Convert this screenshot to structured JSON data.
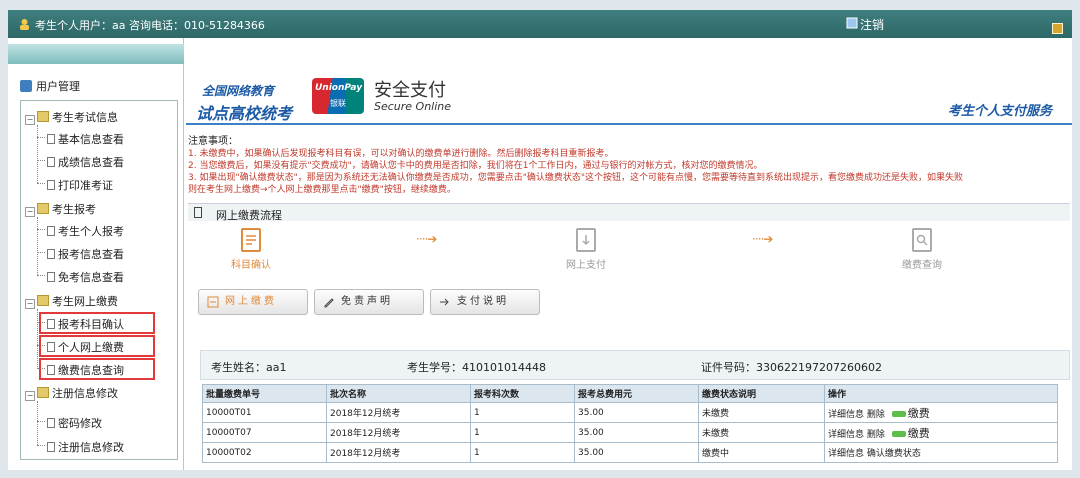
{
  "topbar": {
    "user_info": "考生个人用户：aa 咨询电话：010-51284366",
    "logout": "注销"
  },
  "sidebar": {
    "header": "用户管理",
    "groups": [
      {
        "label": "考生考试信息",
        "items": [
          "基本信息查看",
          "成绩信息查看",
          "打印准考证"
        ]
      },
      {
        "label": "考生报考",
        "items": [
          "考生个人报考",
          "报考信息查看",
          "免考信息查看"
        ]
      },
      {
        "label": "考生网上缴费",
        "items": [
          "报考科目确认",
          "个人网上缴费",
          "缴费信息查询"
        ]
      },
      {
        "label": "注册信息修改",
        "items": [
          "密码修改",
          "注册信息修改"
        ]
      }
    ]
  },
  "banner": {
    "title_line1": "全国网络教育",
    "title_line2": "试点高校统考",
    "unionpay_en": "UnionPay",
    "unionpay_cn": "银联",
    "secure_cn": "安全支付",
    "secure_en": "Secure Online",
    "right_title": "考生个人支付服务"
  },
  "notice": {
    "heading": "注意事项：",
    "lines": [
      "1. 未缴费中，如果确认后发现报考科目有误，可以对确认的缴费单进行删除。然后删除报考科目重新报考。",
      "2. 当您缴费后，如果没有提示\"交费成功\"，请确认您卡中的费用是否扣除，我们将在1个工作日内，通过与银行的对帐方式，核对您的缴费情况。",
      "3. 如果出现\"确认缴费状态\"，那是因为系统还无法确认你缴费是否成功，您需要点击\"确认缴费状态\"这个按钮，这个可能有点慢，您需要等待直到系统出现提示，看您缴费成功还是失败，如果失败",
      "则在考生网上缴费→个人网上缴费那里点击\"缴费\"按钮，继续缴费。"
    ]
  },
  "flow": {
    "title": "网上缴费流程",
    "steps": [
      "科目确认",
      "网上支付",
      "缴费查询"
    ],
    "arrow": "····➔"
  },
  "buttons": {
    "online_pay": "网上缴费",
    "disclaimer": "免责声明",
    "pay_info": "支付说明"
  },
  "student": {
    "name": "考生姓名：aa1",
    "id_no": "考生学号：410101014448",
    "cert_no": "证件号码：330622197207260602"
  },
  "table": {
    "headers": [
      "批量缴费单号",
      "批次名称",
      "报考科次数",
      "报考总费用元",
      "缴费状态说明",
      "操作"
    ],
    "rows": [
      {
        "cells": [
          "10000T01",
          "2018年12月统考",
          "1",
          "35.00",
          "未缴费"
        ],
        "ops": [
          "详细信息",
          "删除",
          "缴费"
        ]
      },
      {
        "cells": [
          "10000T07",
          "2018年12月统考",
          "1",
          "35.00",
          "未缴费"
        ],
        "ops": [
          "详细信息",
          "删除",
          "缴费"
        ]
      },
      {
        "cells": [
          "10000T02",
          "2018年12月统考",
          "1",
          "35.00",
          "缴费中"
        ],
        "ops": [
          "详细信息",
          "确认缴费状态"
        ]
      }
    ]
  },
  "colors": {
    "topbar": "#2e6767",
    "brand_blue": "#1d5aa6",
    "notice_red": "#c0392b",
    "highlight_red": "#e23a3a",
    "accent_orange": "#e08a3c"
  }
}
